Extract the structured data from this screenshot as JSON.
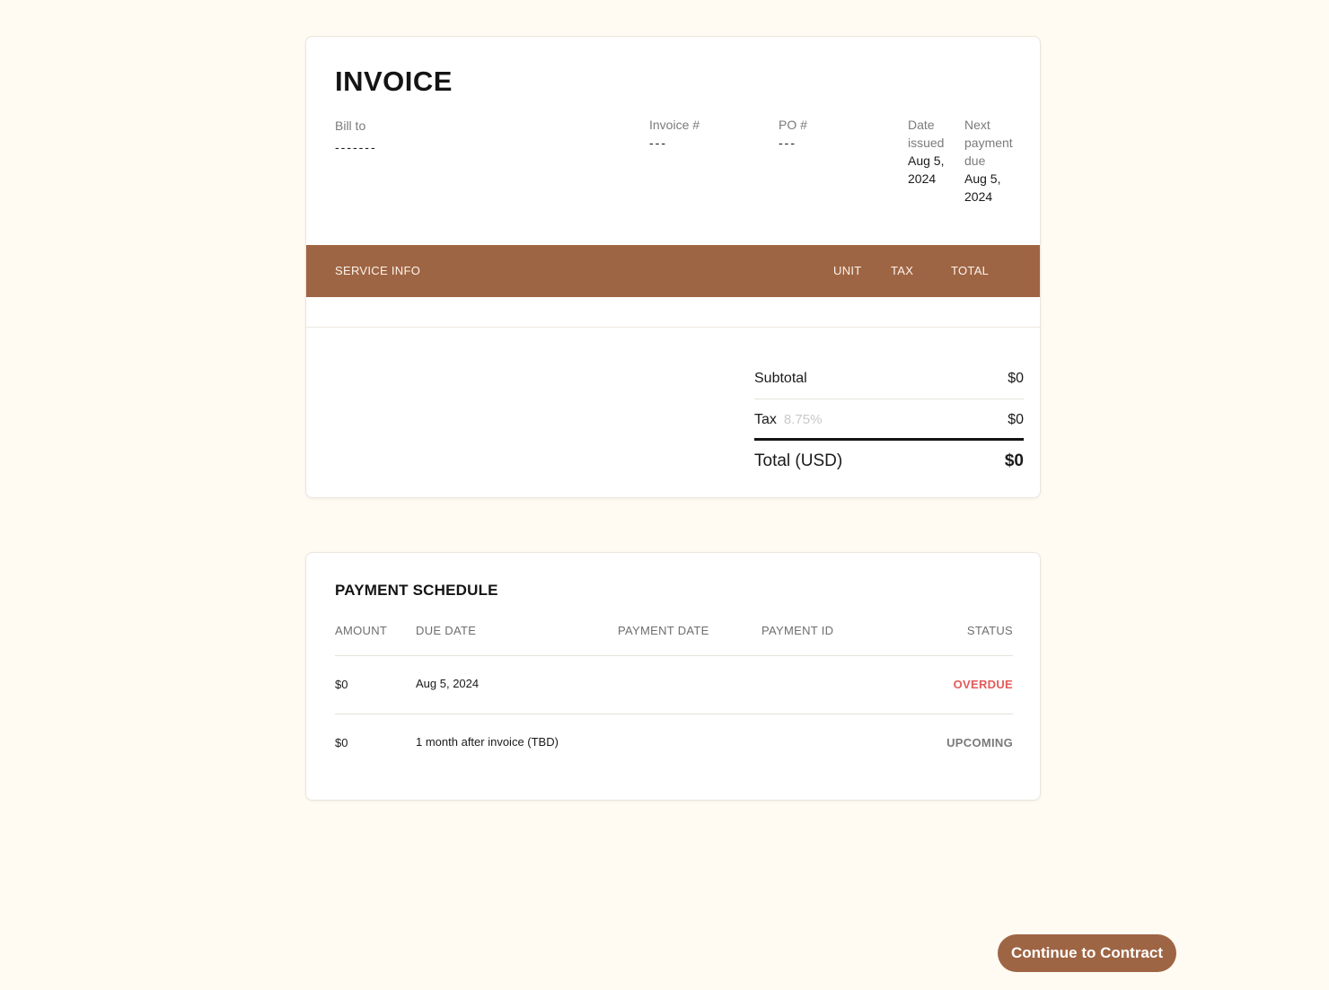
{
  "invoice": {
    "title": "INVOICE",
    "bill_to_label": "Bill to",
    "bill_to_value": "-------",
    "invoice_num_label": "Invoice #",
    "invoice_num_value": "---",
    "po_label": "PO #",
    "po_value": "---",
    "date_issued_label": "Date issued",
    "date_issued_value": "Aug 5, 2024",
    "next_due_label": "Next payment due",
    "next_due_value": "Aug 5, 2024"
  },
  "service_table": {
    "headers": {
      "service": "SERVICE INFO",
      "unit": "UNIT",
      "tax": "TAX",
      "total": "TOTAL"
    },
    "header_color": "#9e6544"
  },
  "totals": {
    "subtotal_label": "Subtotal",
    "subtotal_value": "$0",
    "tax_label": "Tax",
    "tax_rate": "8.75%",
    "tax_value": "$0",
    "total_label": "Total (USD)",
    "total_value": "$0"
  },
  "schedule": {
    "title": "PAYMENT SCHEDULE",
    "headers": {
      "amount": "AMOUNT",
      "due_date": "DUE DATE",
      "payment_date": "PAYMENT DATE",
      "payment_id": "PAYMENT ID",
      "status": "STATUS"
    },
    "rows": [
      {
        "amount": "$0",
        "due_date": "Aug 5, 2024",
        "payment_date": "",
        "payment_id": "",
        "status": "OVERDUE"
      },
      {
        "amount": "$0",
        "due_date": "1 month after invoice (TBD)",
        "payment_date": "",
        "payment_id": "",
        "status": "UPCOMING"
      }
    ],
    "status_colors": {
      "overdue": "#e55a5a",
      "upcoming": "#7a7a7a"
    }
  },
  "actions": {
    "continue_label": "Continue to Contract",
    "accent": "#9e6544"
  }
}
